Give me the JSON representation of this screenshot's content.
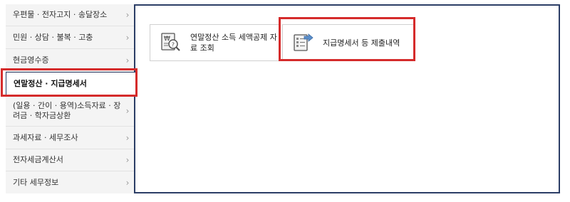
{
  "sidebar": {
    "items": [
      {
        "label": "우편물 · 전자고지 · 송달장소",
        "chevron": "›"
      },
      {
        "label": "민원 · 상담 · 불복 · 고충",
        "chevron": "›"
      },
      {
        "label": "현금영수증",
        "chevron": "›"
      },
      {
        "label": "연말정산 · 지급명세서",
        "chevron": ""
      },
      {
        "label": "(일용 · 간이 · 용역)소득자료 · 장려금 · 학자금상환",
        "chevron": "›"
      },
      {
        "label": "과세자료 · 세무조사",
        "chevron": "›"
      },
      {
        "label": "전자세금계산서",
        "chevron": "›"
      },
      {
        "label": "기타 세무정보",
        "chevron": "›"
      }
    ],
    "active_index": 3
  },
  "main": {
    "cards": [
      {
        "label": "연말정산 소득 세액공제 자료 조회",
        "icon": "document-search-icon"
      },
      {
        "label": "지급명세서 등 제출내역",
        "icon": "document-submit-icon"
      }
    ]
  },
  "colors": {
    "highlight": "#d52b2b",
    "border": "#2c3e66",
    "sidebar_bg": "#f4f4f4"
  }
}
